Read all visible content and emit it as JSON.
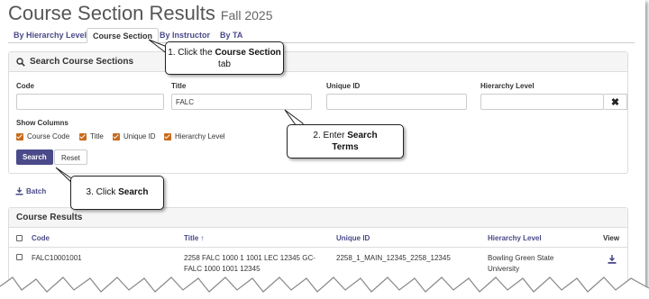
{
  "page": {
    "title": "Course Section Results",
    "subtitle": "Fall 2025"
  },
  "tabs": [
    {
      "label": "By Hierarchy Level",
      "active": false
    },
    {
      "label": "Course Section",
      "active": true
    },
    {
      "label": "By Instructor",
      "active": false
    },
    {
      "label": "By TA",
      "active": false
    }
  ],
  "search_panel": {
    "heading": "Search Course Sections",
    "fields": {
      "code": {
        "label": "Code",
        "value": ""
      },
      "title": {
        "label": "Title",
        "value": "FALC"
      },
      "unique_id": {
        "label": "Unique ID",
        "value": ""
      },
      "hierarchy_level": {
        "label": "Hierarchy Level",
        "value": ""
      }
    },
    "clear_glyph": "✖",
    "show_columns": {
      "label": "Show Columns",
      "items": [
        "Course Code",
        "Title",
        "Unique ID",
        "Hierarchy Level"
      ]
    },
    "search_label": "Search",
    "reset_label": "Reset"
  },
  "batch_label": "Batch",
  "results": {
    "heading": "Course Results",
    "columns": {
      "code": "Code",
      "title": "Title ↑",
      "unique_id": "Unique ID",
      "hierarchy": "Hierarchy Level",
      "view": "View"
    },
    "rows": [
      {
        "code": "FALC10001001",
        "title_line1": "2258 FALC 1000 1 1001 LEC 12345 GC-",
        "title_line2": "FALC 1000 1001 12345",
        "unique_id": "2258_1_MAIN_12345_2258_12345",
        "hierarchy_line1": "Bowling Green State",
        "hierarchy_line2": "University"
      }
    ]
  },
  "callouts": {
    "step1": {
      "prefix": "1. Click the ",
      "bold": "Course Section",
      "suffix": " tab"
    },
    "step2": {
      "prefix": "2. Enter ",
      "bold": "Search Terms"
    },
    "step3": {
      "prefix": "3. Click ",
      "bold": "Search"
    }
  },
  "colors": {
    "accent": "#4a4a8a",
    "checkbox": "#c96a1b",
    "panel_header": "#f5f5f5"
  }
}
